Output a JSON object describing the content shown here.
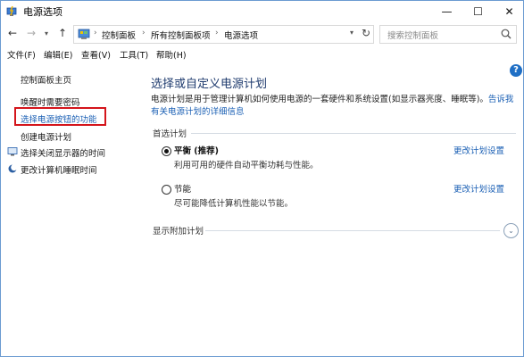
{
  "window": {
    "title": "电源选项",
    "minimize": "—",
    "maximize": "☐",
    "close": "✕"
  },
  "nav": {
    "back": "←",
    "forward": "→",
    "history": "▾",
    "up": "↑",
    "breadcrumb": [
      "控制面板",
      "所有控制面板项",
      "电源选项"
    ],
    "separator": "›",
    "dropdown": "▾",
    "refresh": "↻",
    "search_placeholder": "搜索控制面板"
  },
  "menu": {
    "items": [
      "文件(F)",
      "编辑(E)",
      "查看(V)",
      "工具(T)",
      "帮助(H)"
    ]
  },
  "help_icon": "?",
  "sidebar": {
    "home": "控制面板主页",
    "items": [
      {
        "label": "唤醒时需要密码",
        "icon": ""
      },
      {
        "label": "选择电源按钮的功能",
        "icon": ""
      },
      {
        "label": "创建电源计划",
        "icon": ""
      },
      {
        "label": "选择关闭显示器的时间",
        "icon": "monitor-icon"
      },
      {
        "label": "更改计算机睡眠时间",
        "icon": "moon-icon"
      }
    ]
  },
  "main": {
    "title": "选择或自定义电源计划",
    "description": "电源计划是用于管理计算机如何使用电源的一套硬件和系统设置(如显示器亮度、睡眠等)。",
    "description_link": "告诉我有关电源计划的详细信息",
    "preferred_label": "首选计划",
    "plans": [
      {
        "name": "平衡 (推荐)",
        "desc": "利用可用的硬件自动平衡功耗与性能。",
        "change": "更改计划设置",
        "selected": true
      },
      {
        "name": "节能",
        "desc": "尽可能降低计算机性能以节能。",
        "change": "更改计划设置",
        "selected": false
      }
    ],
    "additional_label": "显示附加计划",
    "expand": "⌄"
  },
  "colors": {
    "link": "#1a5fb4",
    "title": "#1f3b6e",
    "highlight": "#d4151b",
    "help": "#1f6fc5"
  }
}
